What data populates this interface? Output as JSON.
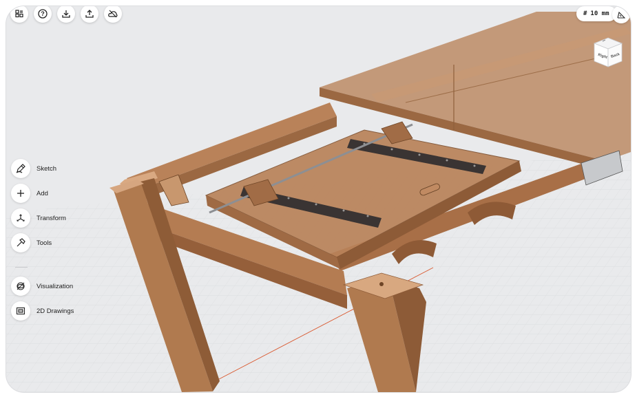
{
  "toolbar": {
    "icons": [
      "settings-sliders-icon",
      "help-icon",
      "download-icon",
      "upload-icon",
      "cloud-icon"
    ]
  },
  "grid": {
    "symbol": "#",
    "value": "10 mm"
  },
  "viewcube": {
    "face_right": "Right",
    "face_back": "Back"
  },
  "tools": [
    {
      "label": "Sketch",
      "icon": "pencil-icon"
    },
    {
      "label": "Add",
      "icon": "plus-icon"
    },
    {
      "label": "Transform",
      "icon": "transform-icon"
    },
    {
      "label": "Tools",
      "icon": "hammer-icon"
    },
    {
      "label": "Visualization",
      "icon": "visualization-icon"
    },
    {
      "label": "2D Drawings",
      "icon": "drawings-icon"
    }
  ],
  "colors": {
    "wood": "#b07a4f",
    "wood_dark": "#8a5a36",
    "wood_light": "#c89a72",
    "background": "#e9eaec",
    "axis": "#d9552b"
  }
}
